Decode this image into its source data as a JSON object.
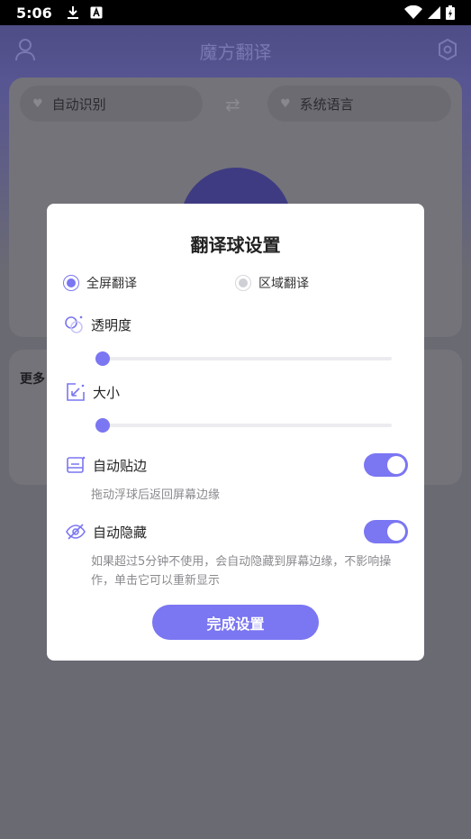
{
  "status_bar": {
    "time": "5:06"
  },
  "app": {
    "title": "魔方翻译",
    "source_lang": "自动识别",
    "target_lang": "系统语言",
    "more_title": "更多"
  },
  "dialog": {
    "title": "翻译球设置",
    "modes": [
      {
        "label": "全屏翻译",
        "selected": true
      },
      {
        "label": "区域翻译",
        "selected": false
      }
    ],
    "opacity": {
      "label": "透明度",
      "value": 0
    },
    "size": {
      "label": "大小",
      "value": 0
    },
    "auto_edge": {
      "label": "自动贴边",
      "enabled": true,
      "hint": "拖动浮球后返回屏幕边缘"
    },
    "auto_hide": {
      "label": "自动隐藏",
      "enabled": true,
      "hint": "如果超过5分钟不使用，会自动隐藏到屏幕边缘，不影响操作，单击它可以重新显示"
    },
    "done_label": "完成设置"
  },
  "colors": {
    "accent": "#7b76f2",
    "scrim": "#6a6a73"
  }
}
